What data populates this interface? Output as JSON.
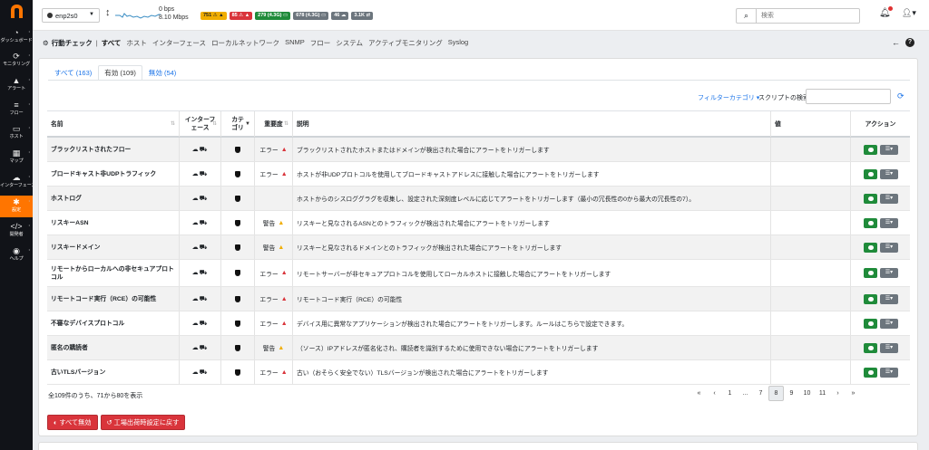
{
  "sidebar": {
    "items": [
      {
        "label": "ダッシュボード",
        "icon": "gauge-icon",
        "glyph": "◔"
      },
      {
        "label": "モニタリング",
        "icon": "monitoring-icon",
        "glyph": "⟳"
      },
      {
        "label": "アラート",
        "icon": "alert-icon",
        "glyph": "▲"
      },
      {
        "label": "フロー",
        "icon": "flow-icon",
        "glyph": "≡"
      },
      {
        "label": "ホスト",
        "icon": "host-icon",
        "glyph": "▭"
      },
      {
        "label": "マップ",
        "icon": "map-icon",
        "glyph": "▦"
      },
      {
        "label": "インターフェース",
        "icon": "interface-icon",
        "glyph": "☁"
      },
      {
        "label": "設定",
        "icon": "settings-icon",
        "glyph": "✱"
      },
      {
        "label": "開発者",
        "icon": "developer-icon",
        "glyph": "</>"
      },
      {
        "label": "ヘルプ",
        "icon": "help-icon",
        "glyph": "◉"
      }
    ],
    "active_index": 7
  },
  "topbar": {
    "interface": "enp2s0",
    "rate_line1": "0 bps",
    "rate_line2": "8.10 Mbps",
    "badges": [
      {
        "text": "751 ⚠ ▲",
        "color": "yellow"
      },
      {
        "text": "85 ⚠ ▲",
        "color": "red"
      },
      {
        "text": "279 (4.3G) ▭",
        "color": "green"
      },
      {
        "text": "678 (4.3G) ▭",
        "color": "gray"
      },
      {
        "text": "46 ☁",
        "color": "gray"
      },
      {
        "text": "3.1K ⇄",
        "color": "gray"
      }
    ],
    "search_placeholder": "検索"
  },
  "breadcrumb": {
    "title": "行動チェック",
    "items": [
      "すべて",
      "ホスト",
      "インターフェース",
      "ローカルネットワーク",
      "SNMP",
      "フロー",
      "システム",
      "アクティブモニタリング",
      "Syslog"
    ],
    "current_index": 0
  },
  "tabs": [
    {
      "label": "すべて (163)"
    },
    {
      "label": "有効 (109)"
    },
    {
      "label": "無効 (54)"
    }
  ],
  "active_tab": 1,
  "filter_category": "フィルターカテゴリ ▾",
  "script_search_label": "スクリプトの検索:",
  "table": {
    "headers": {
      "name": "名前",
      "interface": "インターフェース",
      "category": "カテゴリ",
      "severity": "重要度",
      "description": "説明",
      "value": "値",
      "action": "アクション"
    },
    "rows": [
      {
        "name": "ブラックリストされたフロー",
        "severity": "エラー",
        "level": "error",
        "description": "ブラックリストされたホストまたはドメインが検出された場合にアラートをトリガーします"
      },
      {
        "name": "ブロードキャスト非UDPトラフィック",
        "severity": "エラー",
        "level": "error",
        "description": "ホストが非UDPプロトコルを使用してブロードキャストアドレスに接触した場合にアラートをトリガーします"
      },
      {
        "name": "ホストログ",
        "severity": "",
        "level": "none",
        "description": "ホストからのシスロググラグを収集し、設定された深刻度レベルに応じてアラートをトリガーします（最小の冗長性の0から最大の冗長性の7）。"
      },
      {
        "name": "リスキーASN",
        "severity": "警告",
        "level": "warning",
        "description": "リスキーと見なされるASNとのトラフィックが検出された場合にアラートをトリガーします"
      },
      {
        "name": "リスキードメイン",
        "severity": "警告",
        "level": "warning",
        "description": "リスキーと見なされるドメインとのトラフィックが検出された場合にアラートをトリガーします"
      },
      {
        "name": "リモートからローカルへの非セキュアプロトコル",
        "severity": "エラー",
        "level": "error",
        "description": "リモートサーバーが非セキュアプロトコルを使用してローカルホストに接触した場合にアラートをトリガーします"
      },
      {
        "name": "リモートコード実行（RCE）の可能性",
        "severity": "エラー",
        "level": "error",
        "description": "リモートコード実行（RCE）の可能性"
      },
      {
        "name": "不審なデバイスプロトコル",
        "severity": "エラー",
        "level": "error",
        "description": "デバイス用に異常なアプリケーションが検出された場合にアラートをトリガーします。ルールはこちらで設定できます。"
      },
      {
        "name": "匿名の購読者",
        "severity": "警告",
        "level": "warning",
        "description": "（ソース）IPアドレスが匿名化され、購読者を識別するために使用できない場合にアラートをトリガーします"
      },
      {
        "name": "古いTLSバージョン",
        "severity": "エラー",
        "level": "error",
        "description": "古い（おそらく安全でない）TLSバージョンが検出された場合にアラートをトリガーします"
      }
    ]
  },
  "footer": {
    "showing": "全109件のうち、71から80を表示",
    "pages": [
      "«",
      "‹",
      "1",
      "...",
      "7",
      "8",
      "9",
      "10",
      "11",
      "›",
      "»"
    ],
    "current_page": "8",
    "disable_all": "すべて無効",
    "factory_reset": "工場出荷時設定に戻す"
  },
  "colors": {
    "accent": "#ff7500",
    "link": "#1a73e8",
    "error": "#d9343b",
    "warning": "#f0ad00",
    "enabled": "#1f8b3a"
  }
}
